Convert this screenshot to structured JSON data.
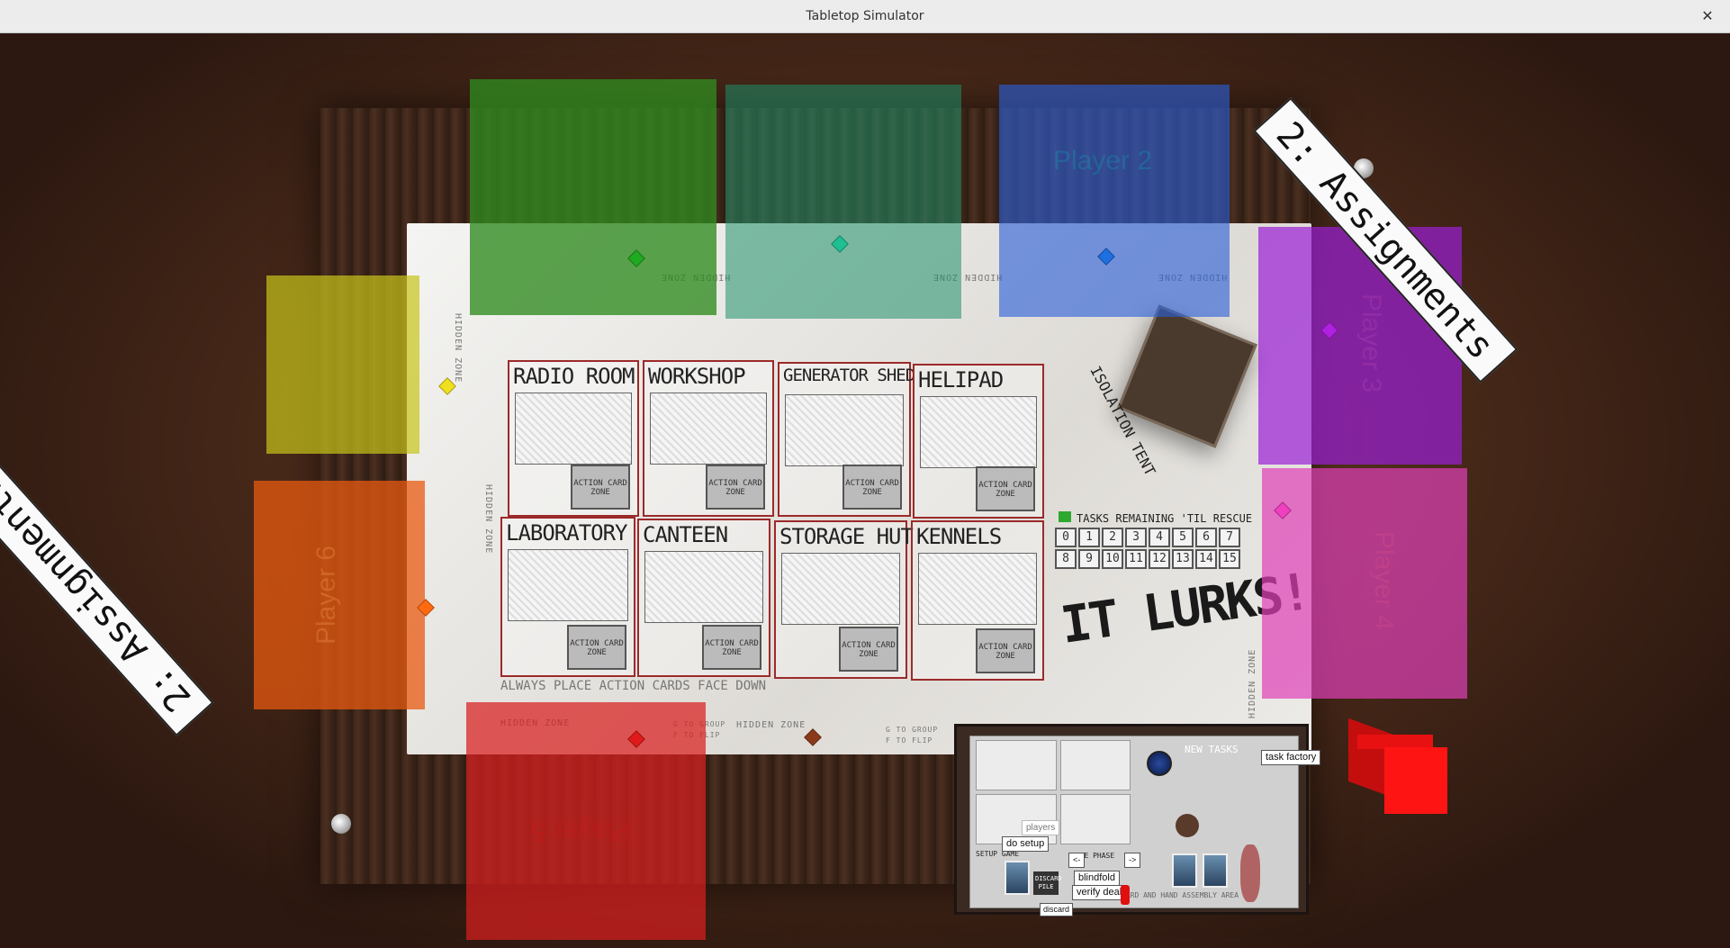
{
  "window": {
    "title": "Tabletop Simulator",
    "close_glyph": "✕"
  },
  "board": {
    "hidden_zone": "HIDDEN ZONE",
    "group_hint": "G TO GROUP",
    "flip_hint": "F TO FLIP",
    "rooms": [
      {
        "name": "RADIO ROOM",
        "action_card": "ACTION CARD ZONE"
      },
      {
        "name": "WORKSHOP",
        "action_card": "ACTION CARD ZONE"
      },
      {
        "name": "GENERATOR SHED",
        "action_card": "ACTION CARD ZONE"
      },
      {
        "name": "HELIPAD",
        "action_card": "ACTION CARD ZONE"
      },
      {
        "name": "LABORATORY",
        "action_card": "ACTION CARD ZONE"
      },
      {
        "name": "CANTEEN",
        "action_card": "ACTION CARD ZONE"
      },
      {
        "name": "STORAGE HUT",
        "action_card": "ACTION CARD ZONE"
      },
      {
        "name": "KENNELS",
        "action_card": "ACTION CARD ZONE"
      }
    ],
    "isolation_tent": "ISOLATION TENT",
    "tasks_remaining": "TASKS REMAINING 'TIL RESCUE",
    "task_numbers": [
      "0",
      "1",
      "2",
      "3",
      "4",
      "5",
      "6",
      "7",
      "8",
      "9",
      "10",
      "11",
      "12",
      "13",
      "14",
      "15"
    ],
    "title": "IT LURKS!",
    "always_place": "ALWAYS PLACE ACTION CARDS FACE DOWN"
  },
  "players": [
    {
      "label": "",
      "color": "#2f8a1f"
    },
    {
      "label": "",
      "color": "#1e8f6a"
    },
    {
      "label": "Player 2",
      "color": "#2b5fd9"
    },
    {
      "label": "Player 3",
      "color": "#9b1fd6"
    },
    {
      "label": "Player 4",
      "color": "#e040b8"
    },
    {
      "label": "Player 5",
      "color": "#d81f1f"
    },
    {
      "label": "Player 6",
      "color": "#e85a10"
    },
    {
      "label": "",
      "color": "#c8c41a"
    }
  ],
  "banners": {
    "top": "2: Assignments",
    "bottom": "2: Assignments"
  },
  "setup_board": {
    "new_tasks": "NEW TASKS",
    "task_factory": "task factory",
    "do_setup": "do setup",
    "players_label": "players",
    "prev_btn": "<-",
    "next_btn": "->",
    "phase_label": "GAME PHASE",
    "blindfold": "blindfold",
    "verify_deal": "verify deal",
    "discard": "discard",
    "discard_pile": "DISCARD PILE",
    "setup_game": "SETUP GAME",
    "assembly_area": "CARD AND HAND ASSEMBLY AREA"
  }
}
